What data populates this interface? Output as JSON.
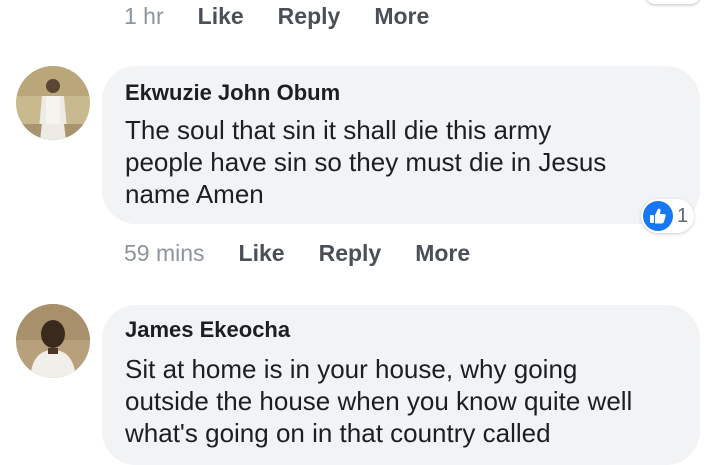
{
  "top_comment": {
    "time": "1 hr",
    "like_label": "Like",
    "reply_label": "Reply",
    "more_label": "More"
  },
  "comments": [
    {
      "author": "Ekwuzie John Obum",
      "text": "The soul that sin it shall die this army\npeople have sin so they must die in Jesus\nname Amen",
      "time": "59 mins",
      "like_label": "Like",
      "reply_label": "Reply",
      "more_label": "More",
      "reaction_icon": "thumbs-up-icon",
      "reaction_count": "1",
      "reaction_color": "#1877f2"
    },
    {
      "author": "James Ekeocha",
      "text": "Sit at home is in your house, why going\noutside the house when you know quite well\nwhat's going on in that country called"
    }
  ],
  "colors": {
    "bubble": "#f2f3f5",
    "meta_text": "#4b4f56",
    "time_text": "#8d949e",
    "like_blue": "#1877f2"
  }
}
